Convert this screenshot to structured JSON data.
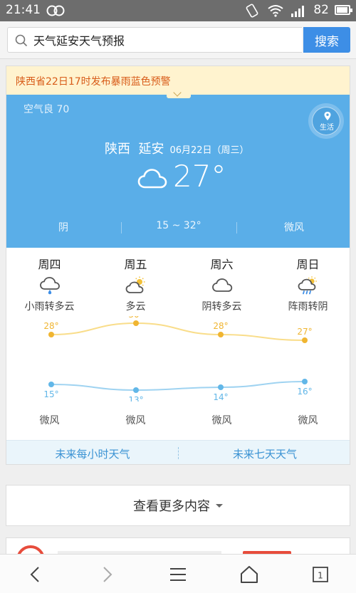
{
  "status_bar": {
    "time": "21:41",
    "battery": "82"
  },
  "search": {
    "query": "天气延安天气预报",
    "button_label": "搜索"
  },
  "alert": {
    "text": "陕西省22日17时发布暴雨蓝色预警"
  },
  "current": {
    "air_quality": "空气良 70",
    "life_label": "生活",
    "province": "陕西",
    "city": "延安",
    "date": "06月22日（周三）",
    "temperature": "27°",
    "condition": "阴",
    "range": "15 ~ 32°",
    "wind": "微风"
  },
  "forecast": [
    {
      "day": "周四",
      "icon": "rain-icon",
      "cond": "小雨转多云",
      "high": "28°",
      "low": "15°",
      "wind": "微风"
    },
    {
      "day": "周五",
      "icon": "partly-cloudy-icon",
      "cond": "多云",
      "high": "30°",
      "low": "13°",
      "wind": "微风"
    },
    {
      "day": "周六",
      "icon": "cloud-icon",
      "cond": "阴转多云",
      "high": "28°",
      "low": "14°",
      "wind": "微风"
    },
    {
      "day": "周日",
      "icon": "shower-icon",
      "cond": "阵雨转阴",
      "high": "27°",
      "low": "16°",
      "wind": "微风"
    }
  ],
  "chart_data": {
    "type": "line",
    "categories": [
      "周四",
      "周五",
      "周六",
      "周日"
    ],
    "series": [
      {
        "values": [
          28,
          30,
          28,
          27
        ],
        "color": "#f2c037"
      },
      {
        "values": [
          15,
          13,
          14,
          16
        ],
        "color": "#7cc3ec"
      }
    ]
  },
  "links": {
    "hourly": "未来每小时天气",
    "seven_day": "未来七天天气"
  },
  "more": {
    "label": "查看更多内容"
  },
  "colors": {
    "accent": "#3d8ee6",
    "hero_bg": "#5aaee8",
    "alert_text": "#d85c19",
    "link": "#3a92d3"
  }
}
